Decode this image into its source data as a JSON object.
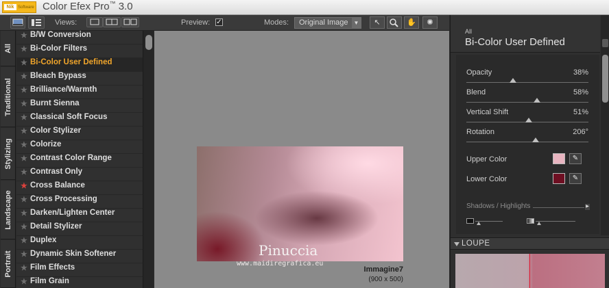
{
  "app": {
    "logo_mark": "Nik",
    "logo_sub": "Software",
    "title": "Color Efex Pro",
    "trademark": "™",
    "version": "3.0"
  },
  "toolbar": {
    "views_label": "Views:",
    "preview_label": "Preview:",
    "preview_checked": "✓",
    "modes_label": "Modes:",
    "mode_selected": "Original Image",
    "tools": [
      "pointer-icon",
      "zoom-icon",
      "hand-icon",
      "light-bulb-icon"
    ]
  },
  "category_tabs": [
    "All",
    "Traditional",
    "Stylizing",
    "Landscape",
    "Portrait"
  ],
  "filters": [
    {
      "label": "B/W Conversion"
    },
    {
      "label": "Bi-Color Filters"
    },
    {
      "label": "Bi-Color User Defined",
      "active": true
    },
    {
      "label": "Bleach Bypass"
    },
    {
      "label": "Brilliance/Warmth"
    },
    {
      "label": "Burnt Sienna"
    },
    {
      "label": "Classical Soft Focus"
    },
    {
      "label": "Color Stylizer"
    },
    {
      "label": "Colorize"
    },
    {
      "label": "Contrast Color Range"
    },
    {
      "label": "Contrast Only"
    },
    {
      "label": "Cross Balance",
      "favorite": true
    },
    {
      "label": "Cross Processing"
    },
    {
      "label": "Darken/Lighten Center"
    },
    {
      "label": "Detail Stylizer"
    },
    {
      "label": "Duplex"
    },
    {
      "label": "Dynamic Skin Softener"
    },
    {
      "label": "Film Effects"
    },
    {
      "label": "Film Grain"
    }
  ],
  "preview": {
    "signature": "Pinuccia",
    "signature_url": "www.maidiregrafica.eu",
    "image_name": "Immagine7",
    "image_size": "(900 x 500)"
  },
  "panel": {
    "category": "All",
    "filter_title": "Bi-Color User Defined",
    "sliders": [
      {
        "label": "Opacity",
        "value": "38%",
        "level": 0.38
      },
      {
        "label": "Blend",
        "value": "58%",
        "level": 0.58
      },
      {
        "label": "Vertical Shift",
        "value": "51%",
        "level": 0.51
      },
      {
        "label": "Rotation",
        "value": "206°",
        "level": 0.57
      }
    ],
    "upper_color_label": "Upper Color",
    "upper_color": "#e8b4c0",
    "lower_color_label": "Lower Color",
    "lower_color": "#6e0f22",
    "shadows_label": "Shadows / Highlights",
    "loupe_label": "LOUPE"
  },
  "colors": {
    "active_filter": "#f0a52b",
    "favorite_star": "#d9413c",
    "loupe_split": "#e0102a"
  }
}
